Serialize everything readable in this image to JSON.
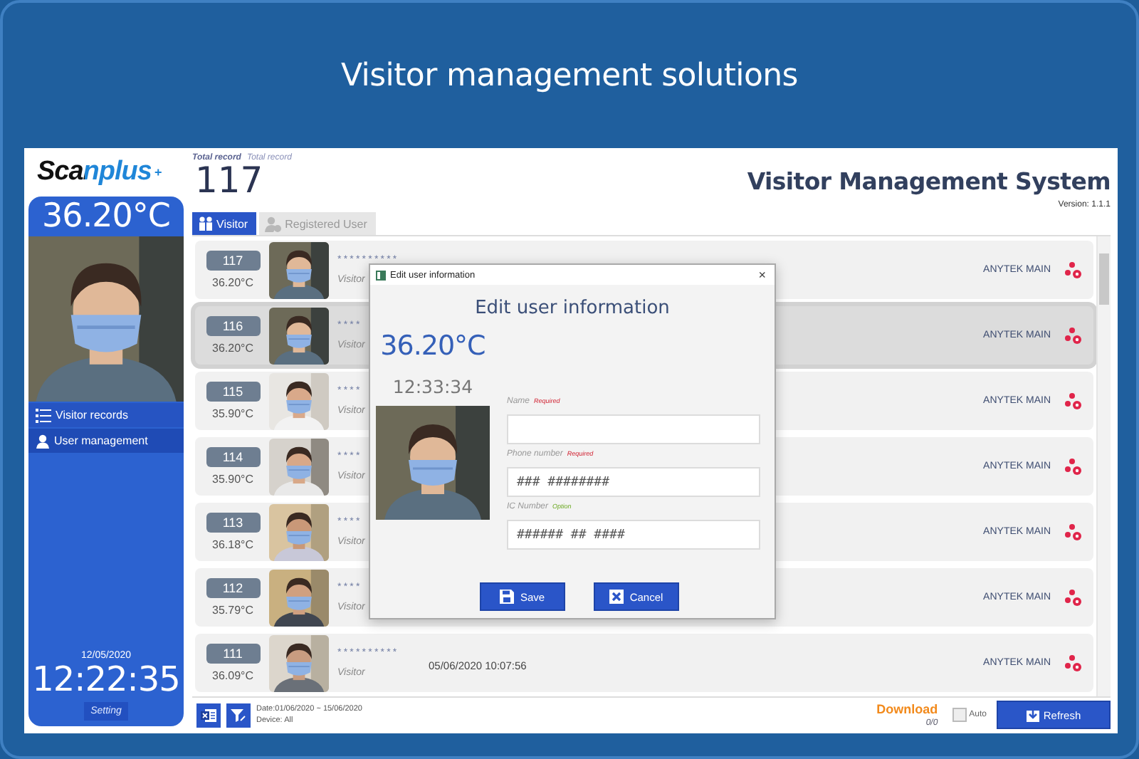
{
  "banner": {
    "title": "Visitor management solutions"
  },
  "logo": {
    "text": "Scanplus",
    "mark": "+"
  },
  "sidebar": {
    "temperature": "36.20°C",
    "menu": [
      {
        "label": "Visitor records",
        "kind": "list",
        "selected": false
      },
      {
        "label": "User management",
        "kind": "user",
        "selected": true
      }
    ],
    "date": "12/05/2020",
    "clock": "12:22:35",
    "setting_button": "Setting"
  },
  "header": {
    "total_label": "Total record",
    "total_label_2": "Total record",
    "total": "117",
    "title": "Visitor Management System",
    "version": "Version: 1.1.1"
  },
  "tabs": [
    {
      "label": "Visitor",
      "kind": "visitor",
      "selected": true
    },
    {
      "label": "Registered User",
      "kind": "registered",
      "selected": false
    }
  ],
  "rows": [
    {
      "number": "117",
      "temperature": "36.20°C",
      "name": "**********",
      "type": "Visitor",
      "device": "ANYTEK MAIN",
      "selected": false
    },
    {
      "number": "116",
      "temperature": "36.20°C",
      "name": "****",
      "type": "Visitor",
      "device": "ANYTEK MAIN",
      "selected": true
    },
    {
      "number": "115",
      "temperature": "35.90°C",
      "name": "****",
      "type": "Visitor",
      "device": "ANYTEK MAIN",
      "selected": false
    },
    {
      "number": "114",
      "temperature": "35.90°C",
      "name": "****",
      "type": "Visitor",
      "device": "ANYTEK MAIN",
      "selected": false
    },
    {
      "number": "113",
      "temperature": "36.18°C",
      "name": "****",
      "type": "Visitor",
      "device": "ANYTEK MAIN",
      "selected": false
    },
    {
      "number": "112",
      "temperature": "35.79°C",
      "name": "****",
      "type": "Visitor",
      "device": "ANYTEK MAIN",
      "selected": false
    },
    {
      "number": "111",
      "temperature": "36.09°C",
      "name": "**********",
      "type": "Visitor",
      "datetime": "05/06/2020 10:07:56",
      "device": "ANYTEK MAIN",
      "selected": false
    }
  ],
  "footer": {
    "date_range": "Date:01/06/2020 ~ 15/06/2020",
    "device": "Device: All",
    "download": "Download",
    "progress": "0/0",
    "auto": {
      "label": "Auto",
      "checked": false
    },
    "refresh_button": "Refresh"
  },
  "dialog": {
    "window_title": "Edit user information",
    "close": "×",
    "heading": "Edit user information",
    "temperature": "36.20°C",
    "time": "12:33:34",
    "fields": [
      {
        "label": "Name",
        "tag": "Required",
        "kind": "required"
      },
      {
        "label": "Phone number",
        "tag": "Required",
        "kind": "required",
        "value": "### ########"
      },
      {
        "label": "IC Number",
        "tag": "Option",
        "kind": "optional",
        "value": "###### ## ####"
      }
    ],
    "buttons": [
      {
        "label": "Save",
        "kind": "save"
      },
      {
        "label": "Cancel",
        "kind": "cancel"
      }
    ]
  }
}
